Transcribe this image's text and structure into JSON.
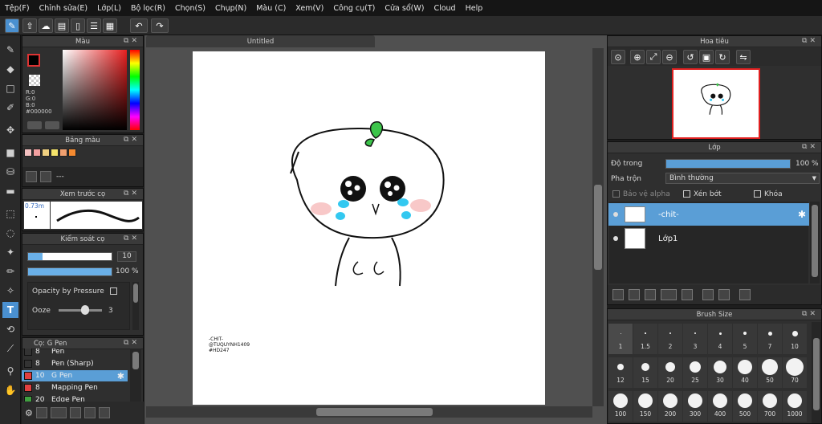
{
  "menu": [
    "Tệp(F)",
    "Chỉnh sửa(E)",
    "Lớp(L)",
    "Bộ lọc(R)",
    "Chọn(S)",
    "Chụp(N)",
    "Màu (C)",
    "Xem(V)",
    "Công cụ(T)",
    "Cửa sổ(W)",
    "Cloud",
    "Help"
  ],
  "color_panel": {
    "title": "Màu",
    "r": "R:0",
    "g": "G:0",
    "b": "B:0",
    "hex": "#000000"
  },
  "palette_panel": {
    "title": "Bảng màu",
    "dash": "---",
    "swatches": [
      "#f4c1c1",
      "#f3a0a0",
      "#f0d080",
      "#f5e36a",
      "#f0a070",
      "#f58a30"
    ]
  },
  "preview_panel": {
    "title": "Xem trước cọ",
    "size": "0.73m"
  },
  "brush_ctrl": {
    "title": "Kiểm soát cọ",
    "size_val": "10",
    "opacity_val": "100 %",
    "pressure_label": "Opacity by Pressure",
    "ooze_label": "Ooze",
    "ooze_val": "3"
  },
  "brush_list": {
    "title": "Cọ: G Pen",
    "items": [
      {
        "size": "8",
        "name": "Pen",
        "color": "#333333"
      },
      {
        "size": "8",
        "name": "Pen (Sharp)",
        "color": "#333333"
      },
      {
        "size": "10",
        "name": "G Pen",
        "color": "#e04040",
        "selected": true
      },
      {
        "size": "8",
        "name": "Mapping Pen",
        "color": "#e04040"
      },
      {
        "size": "20",
        "name": "Edge Pen",
        "color": "#40a040"
      }
    ]
  },
  "canvas": {
    "tab": "Untitled",
    "signature": [
      "-CHIT-",
      "@TUQUYNH1409",
      "#HD247"
    ]
  },
  "navigator": {
    "title": "Hoa tiêu"
  },
  "layer_panel": {
    "title": "Lớp",
    "opacity_label": "Độ trong",
    "opacity_val": "100 %",
    "opacity": 1.0,
    "blend_label": "Pha trộn",
    "blend_val": "Bình thường",
    "protect_alpha": "Bảo vệ alpha",
    "clipping": "Xén bớt",
    "lock": "Khóa",
    "layers": [
      {
        "name": "-chit-",
        "selected": true
      },
      {
        "name": "Lớp1",
        "selected": false
      }
    ]
  },
  "brush_size": {
    "title": "Brush Size",
    "rows": [
      [
        "1",
        "1.5",
        "2",
        "3",
        "4",
        "5",
        "7",
        "10"
      ],
      [
        "12",
        "15",
        "20",
        "25",
        "30",
        "40",
        "50",
        "70"
      ],
      [
        "100",
        "150",
        "200",
        "300",
        "400",
        "500",
        "700",
        "1000"
      ]
    ]
  }
}
